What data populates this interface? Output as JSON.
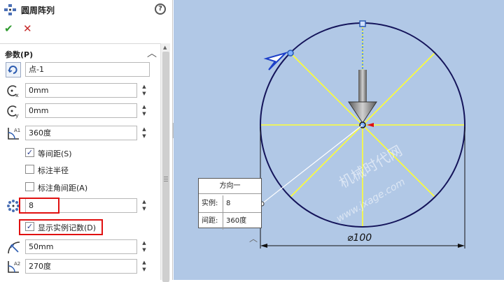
{
  "panel": {
    "title": "圆周阵列",
    "help_symbol": "?",
    "ok_symbol": "✔",
    "cancel_symbol": "✕",
    "section_title": "参数(P)",
    "center_point": "点-1",
    "x_offset": "0mm",
    "y_offset": "0mm",
    "angle": "360度",
    "equal_spacing": {
      "label": "等间距(S)",
      "checked": true
    },
    "dim_radius": {
      "label": "标注半径",
      "checked": false
    },
    "dim_angle": {
      "label": "标注角间距(A)",
      "checked": false
    },
    "instances": "8",
    "show_count": {
      "label": "显示实例记数(D)",
      "checked": true
    },
    "radius": "50mm",
    "arc_angle": "270度"
  },
  "callout": {
    "title": "方向一",
    "rows": [
      {
        "key": "实例:",
        "value": "8"
      },
      {
        "key": "间距:",
        "value": "360度"
      }
    ]
  },
  "drawing": {
    "diameter_label": "⌀100",
    "watermark_cn": "机械时代网",
    "watermark_url": "www.jxage.com",
    "colors": {
      "background": "#b1c8e6",
      "circle": "#14145a",
      "spokes": "#ffff33",
      "direction_line": "#4a8cf0",
      "highlight_box": "#e01010"
    }
  }
}
